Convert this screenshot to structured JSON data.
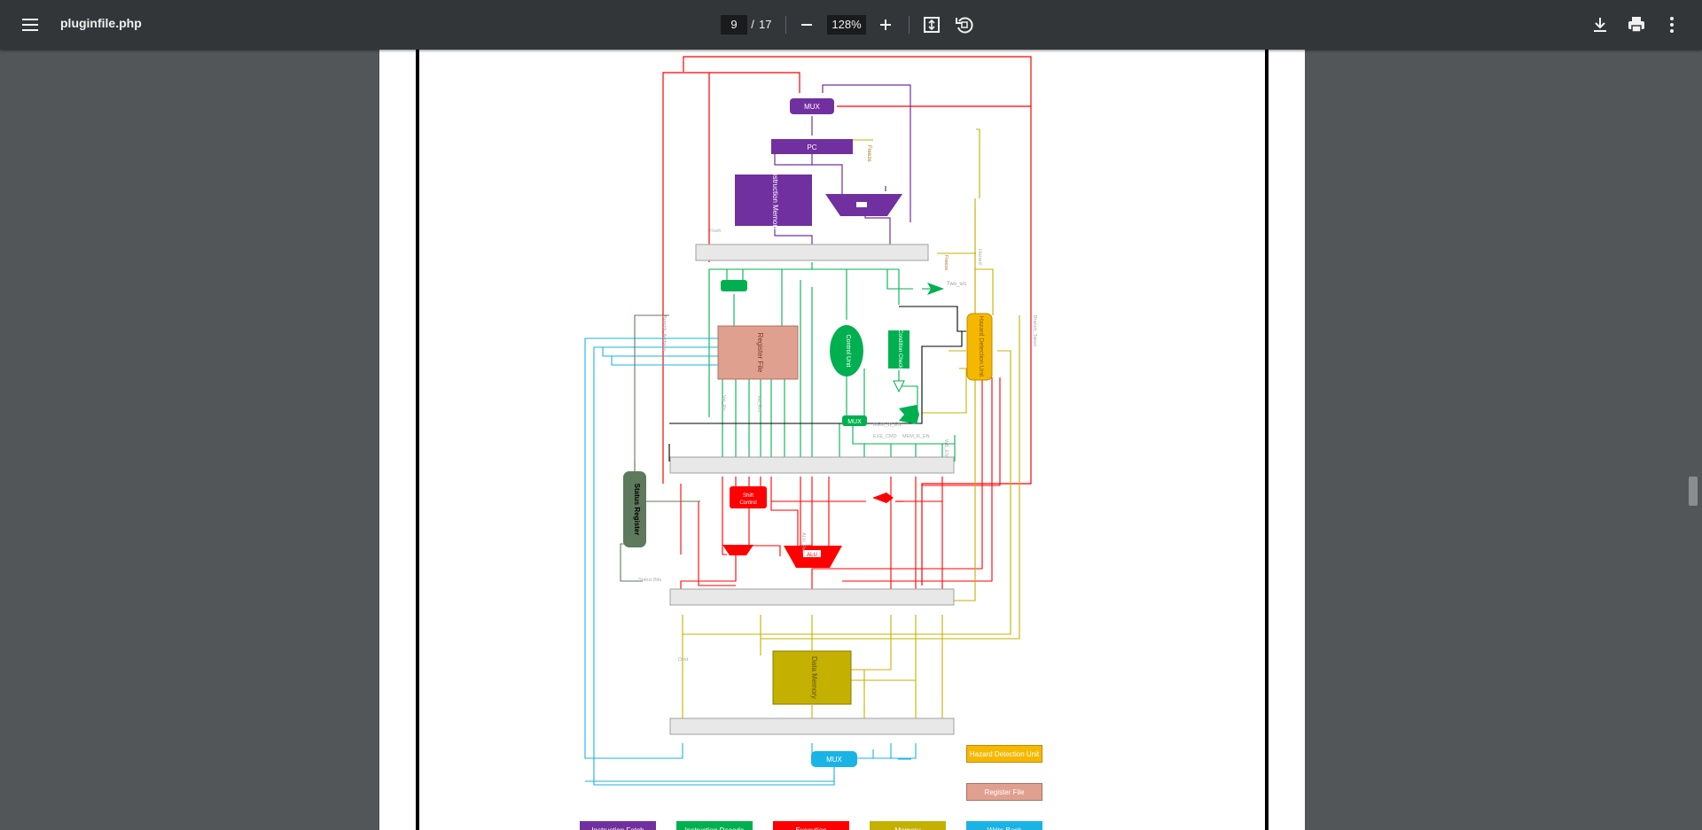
{
  "toolbar": {
    "title": "pluginfile.php",
    "page_current": "9",
    "page_separator": "/",
    "page_total": "17",
    "zoom": "128%"
  },
  "icons": [
    "menu-icon",
    "minus-icon",
    "plus-icon",
    "fit-page-icon",
    "rotate-icon",
    "download-icon",
    "print-icon",
    "more-vert-icon"
  ],
  "diagram": {
    "blocks": {
      "pc_mux": "MUX",
      "pc": "PC",
      "instruction_memory": "Instruction\nMemory",
      "register_file": "Register File",
      "control_unit": "Control Unit",
      "decode_mux": "MUX",
      "ex_mux": "MUX",
      "status_register": "Status Register",
      "shift_control": "Shift\nControl",
      "alu": "ALU",
      "data_memory": "Data Memory",
      "wb_mux": "MUX",
      "hazard_unit": "Hazard Detection\nUnit",
      "condition_check": "Condition\nCheck"
    },
    "signals": {
      "freeze_pc": "Freeze",
      "freeze_ifid": "Freeze",
      "flush": "Flush",
      "branch_address": "Branch_Address",
      "branch_taken": "Branch_Taken",
      "two_src": "Two_src",
      "mem_r_en": "MEM_R_EN",
      "mem_w_en": "MEM_W_EN",
      "exe_cmd": "EXE_CMD",
      "wb_en": "WB_EN",
      "val_rm": "Val_Rm",
      "val_rn": "Val_Rn",
      "alu_res": "ALU_Res",
      "dest": "Dest",
      "status_bits": "Status Bits",
      "hazard": "Hazard"
    },
    "legend": {
      "hazard_detection": "Hazard Detection Unit",
      "register_file": "Register File",
      "bottom": [
        "Instruction Fetch",
        "Instruction Decode",
        "Execution",
        "Memory",
        "Write Back"
      ]
    },
    "colors": {
      "fetch": "#7030a0",
      "decode": "#00b050",
      "execute": "#ff0000",
      "memory": "#c4b000",
      "writeback": "#19b3e6",
      "hazard": "#f5b800",
      "register_file": "#e0a090",
      "status": "#5d7a5d",
      "pipeline_reg": "#e8e8e8"
    }
  }
}
